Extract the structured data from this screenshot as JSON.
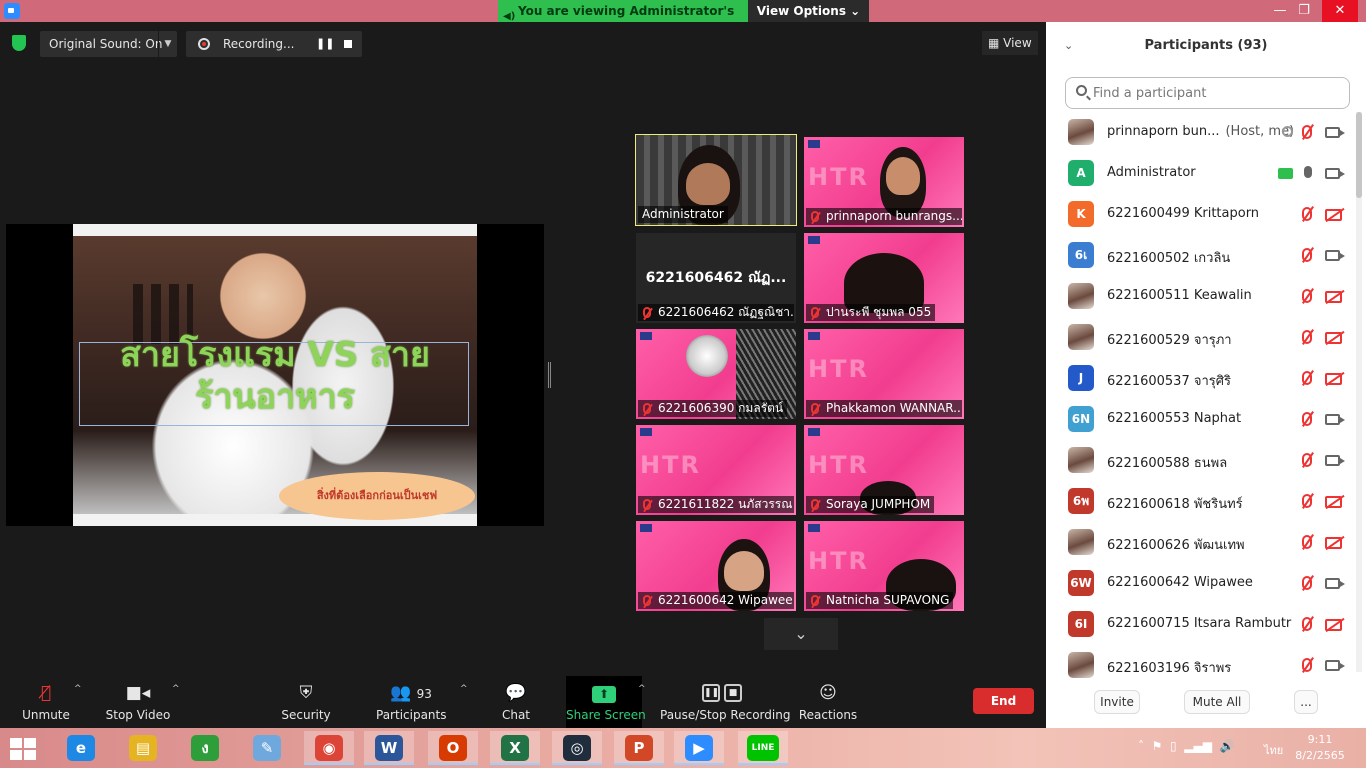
{
  "titlebar": {
    "share_banner": "You are viewing Administrator's screen",
    "view_options": "View Options ⌄",
    "minimize": "—",
    "maximize": "❐",
    "close": "✕"
  },
  "meeting": {
    "original_sound": "Original Sound: On",
    "recording_label": "Recording...",
    "view_label": "View"
  },
  "slide": {
    "title_line1": "สายโรงแรม VS สาย",
    "title_line2": "ร้านอาหาร",
    "pill_text": "สิ่งที่ต้องเลือกก่อนเป็นเชฟ"
  },
  "gallery": {
    "tiles": [
      {
        "name": "Administrator",
        "muted": false
      },
      {
        "name": "prinnaporn bunrangs...",
        "muted": true
      },
      {
        "name": "6221606462 ณัฏฐณิชา...",
        "muted": true,
        "display_name": "6221606462 ณัฏ..."
      },
      {
        "name": "ปานระพี ชุมพล 055",
        "muted": true
      },
      {
        "name": "6221606390 กมลรัตน์",
        "muted": true
      },
      {
        "name": "Phakkamon WANNAR...",
        "muted": true
      },
      {
        "name": "6221611822 นภัสวรรณ",
        "muted": true
      },
      {
        "name": "Soraya JUMPHOM",
        "muted": true
      },
      {
        "name": "6221600642 Wipawee",
        "muted": true
      },
      {
        "name": "Natnicha SUPAVONG",
        "muted": true
      }
    ]
  },
  "toolbar": {
    "unmute": "Unmute",
    "stop_video": "Stop Video",
    "security": "Security",
    "participants": "Participants",
    "participants_count": "93",
    "chat": "Chat",
    "share_screen": "Share Screen",
    "pause_stop_recording": "Pause/Stop Recording",
    "reactions": "Reactions",
    "end": "End"
  },
  "panel": {
    "title": "Participants (93)",
    "search_placeholder": "Find a participant",
    "invite": "Invite",
    "mute_all": "Mute All",
    "more": "...",
    "participants": [
      {
        "name": "prinnaporn bun...",
        "role": "(Host, me)",
        "avatar": "",
        "color": "",
        "mic": "off",
        "video": "on",
        "extra": "rec"
      },
      {
        "name": "Administrator",
        "role": "",
        "avatar": "A",
        "color": "#1fae6b",
        "mic": "on",
        "video": "on",
        "extra": "share"
      },
      {
        "name": "6221600499 Krittaporn",
        "role": "",
        "avatar": "K",
        "color": "#f26b2b",
        "mic": "off",
        "video": "off",
        "extra": ""
      },
      {
        "name": "6221600502 เกวลิน",
        "role": "",
        "avatar": "6เ",
        "color": "#3b7ed1",
        "mic": "off",
        "video": "on",
        "extra": ""
      },
      {
        "name": "6221600511 Keawalin",
        "role": "",
        "avatar": "",
        "color": "",
        "mic": "off",
        "video": "off",
        "extra": ""
      },
      {
        "name": "6221600529 จารุภา",
        "role": "",
        "avatar": "",
        "color": "",
        "mic": "off",
        "video": "off",
        "extra": ""
      },
      {
        "name": "6221600537 จารุศิริ",
        "role": "",
        "avatar": "J",
        "color": "#2459c9",
        "mic": "off",
        "video": "off",
        "extra": ""
      },
      {
        "name": "6221600553 Naphat",
        "role": "",
        "avatar": "6N",
        "color": "#3fa0d1",
        "mic": "off",
        "video": "on",
        "extra": ""
      },
      {
        "name": "6221600588 ธนพล",
        "role": "",
        "avatar": "",
        "color": "",
        "mic": "off",
        "video": "on",
        "extra": ""
      },
      {
        "name": "6221600618 พัชรินทร์",
        "role": "",
        "avatar": "6พ",
        "color": "#c0392b",
        "mic": "off",
        "video": "off",
        "extra": ""
      },
      {
        "name": "6221600626 พัฒนเทพ",
        "role": "",
        "avatar": "",
        "color": "",
        "mic": "off",
        "video": "off",
        "extra": ""
      },
      {
        "name": "6221600642 Wipawee",
        "role": "",
        "avatar": "6W",
        "color": "#c0392b",
        "mic": "off",
        "video": "on",
        "extra": ""
      },
      {
        "name": "6221600715 Itsara Rambutr",
        "role": "",
        "avatar": "6I",
        "color": "#c0392b",
        "mic": "off",
        "video": "off",
        "extra": ""
      },
      {
        "name": "6221603196 จิราพร",
        "role": "",
        "avatar": "",
        "color": "",
        "mic": "off",
        "video": "on",
        "extra": ""
      }
    ]
  },
  "taskbar": {
    "apps": [
      {
        "name": "internet-explorer",
        "glyph": "e",
        "color": "#1e88e5"
      },
      {
        "name": "file-explorer",
        "glyph": "▤",
        "color": "#e6b422"
      },
      {
        "name": "line-green",
        "glyph": "ง",
        "color": "#2e9e3a"
      },
      {
        "name": "paint",
        "glyph": "✎",
        "color": "#6fa8dc"
      },
      {
        "name": "chrome",
        "glyph": "◉",
        "color": "#db4437"
      },
      {
        "name": "word",
        "glyph": "W",
        "color": "#2b579a"
      },
      {
        "name": "office",
        "glyph": "O",
        "color": "#d83b01"
      },
      {
        "name": "excel",
        "glyph": "X",
        "color": "#217346"
      },
      {
        "name": "webex",
        "glyph": "◎",
        "color": "#1f2d3d"
      },
      {
        "name": "powerpoint",
        "glyph": "P",
        "color": "#d24726"
      },
      {
        "name": "zoom",
        "glyph": "▶",
        "color": "#2d8cff"
      },
      {
        "name": "line",
        "glyph": "LINE",
        "color": "#00c300"
      }
    ],
    "language": "ไทย",
    "time": "9:11",
    "date": "8/2/2565"
  }
}
